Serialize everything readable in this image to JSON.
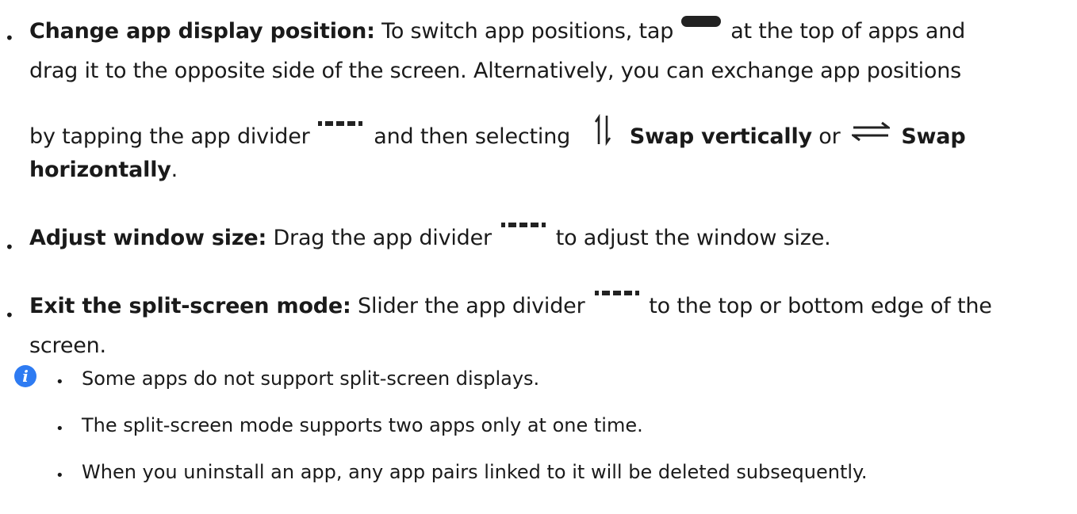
{
  "items": [
    {
      "title": "Change app display position:",
      "line1_a": "To switch app positions, tap",
      "line1_b": "at the top of apps and",
      "line2": "drag it to the opposite side of the screen. Alternatively, you can exchange app positions",
      "line3_a": "by tapping the app divider",
      "line3_b": "and then selecting",
      "swap_v": "Swap vertically",
      "or": "or",
      "swap_h_1": "Swap",
      "swap_h_2": "horizontally",
      "period": "."
    },
    {
      "title": "Adjust window size:",
      "text_a": "Drag the app divider",
      "text_b": "to adjust the window size."
    },
    {
      "title": "Exit the split-screen mode:",
      "text_a": "Slider the app divider",
      "text_b": "to the top or bottom edge of the",
      "text_c": "screen."
    }
  ],
  "note": {
    "icon": "info-icon",
    "icon_glyph": "i",
    "points": [
      "Some apps do not support split-screen displays.",
      "The split-screen mode supports two apps only at one time.",
      "When you uninstall an app, any app pairs linked to it will be deleted subsequently."
    ]
  }
}
